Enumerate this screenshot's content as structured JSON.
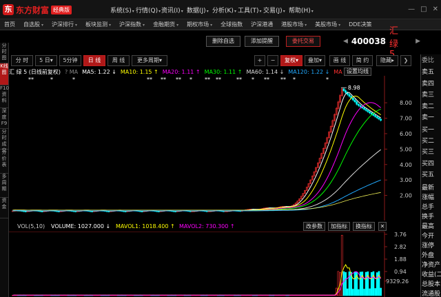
{
  "app": {
    "logo_text": "东方财富",
    "edition": "经典版"
  },
  "menu": [
    "系统(S)",
    "行情(Q)",
    "资讯(I)",
    "数据(J)",
    "分析(K)",
    "工具(T)",
    "交易(J)",
    "帮助(H)"
  ],
  "nav": [
    {
      "label": "首页",
      "dd": false
    },
    {
      "label": "自选股",
      "dd": true
    },
    {
      "label": "沪深排行",
      "dd": true
    },
    {
      "label": "板块监测",
      "dd": true
    },
    {
      "label": "沪深指数",
      "dd": true
    },
    {
      "label": "金融期货",
      "dd": true
    },
    {
      "label": "期权市场",
      "dd": true
    },
    {
      "label": "全球指数",
      "dd": false
    },
    {
      "label": "沪深港通",
      "dd": false
    },
    {
      "label": "港股市场",
      "dd": true
    },
    {
      "label": "美股市场",
      "dd": true
    },
    {
      "label": "DDE决策",
      "dd": false
    }
  ],
  "left_tabs": [
    {
      "label": "分时图",
      "active": false
    },
    {
      "label": "K线图",
      "active": true
    },
    {
      "label": "F10资料",
      "active": false
    },
    {
      "label": "深度F9",
      "active": false
    },
    {
      "label": "分时成交",
      "active": false
    },
    {
      "label": "分价表",
      "active": false
    },
    {
      "label": "多周期",
      "active": false
    },
    {
      "label": "资金",
      "active": false
    }
  ],
  "actions": {
    "delete_fav": "删除自选",
    "add_alert": "添加提醒",
    "trade": "委托交易"
  },
  "stock": {
    "code": "400038",
    "name": "汇 绿 5",
    "prev": "◀",
    "next": "▶"
  },
  "periods": {
    "fenshi": "分 时",
    "day5": "5 日▾",
    "min5": "5分钟",
    "daily": "日 线",
    "weekly": "周 线",
    "more": "更多周期▾",
    "plus": "+",
    "minus": "−",
    "fuquan": "复权▾",
    "overlay": "叠加▾",
    "draw": "画 线",
    "brief": "简 约",
    "hide": "隐藏▸"
  },
  "indicator_title": "汇 绿 5 (日线前复权)",
  "ma": [
    {
      "label": "MA5: 1.22 ↓",
      "color": "#ffffff"
    },
    {
      "label": "MA10: 1.15 ↑",
      "color": "#ffff00"
    },
    {
      "label": "MA20: 1.11 ↑",
      "color": "#ff00ff"
    },
    {
      "label": "MA30: 1.11 ↑",
      "color": "#00ff00"
    },
    {
      "label": "MA60: 1.14 ↓",
      "color": "#dddddd"
    },
    {
      "label": "MA120: 1.22 ↓",
      "color": "#22aaff"
    },
    {
      "label": "MA",
      "color": "#ff3030"
    }
  ],
  "ma_prefix": "? MA",
  "set_ma": "设置均线",
  "peak_label": "8.98",
  "chart_data": {
    "type": "candlestick",
    "y_ticks": [
      "8.00",
      "7.00",
      "6.00",
      "5.00",
      "4.00",
      "3.00",
      "2.00"
    ],
    "ylim": [
      1.0,
      9.3
    ],
    "peak": 8.98,
    "volume_ticks": [
      "3.76",
      "2.82",
      "1.88",
      "0.94",
      "9329.26"
    ]
  },
  "vol": {
    "title": "VOL(5,10)",
    "volume": "VOLUME: 1027.000 ↓",
    "mavol1": "MAVOL1: 1018.400 ↑",
    "mavol2": "MAVOL2: 730.300 ↑",
    "btn_params": "改参数",
    "btn_add": "加指标",
    "btn_switch": "换指标"
  },
  "right": {
    "header": "委比",
    "items": [
      "卖五",
      "卖四",
      "卖三",
      "卖二",
      "卖一",
      "买一",
      "买二",
      "买三",
      "买四",
      "买五",
      "最新",
      "涨幅",
      "总手",
      "换手",
      "最高",
      "今开",
      "涨停",
      "外盘",
      "净资产",
      "收益(二)",
      "总股本",
      "流通股"
    ]
  },
  "colors": {
    "up": "#ff3030",
    "down": "#00ffff",
    "accent": "#b01818"
  }
}
